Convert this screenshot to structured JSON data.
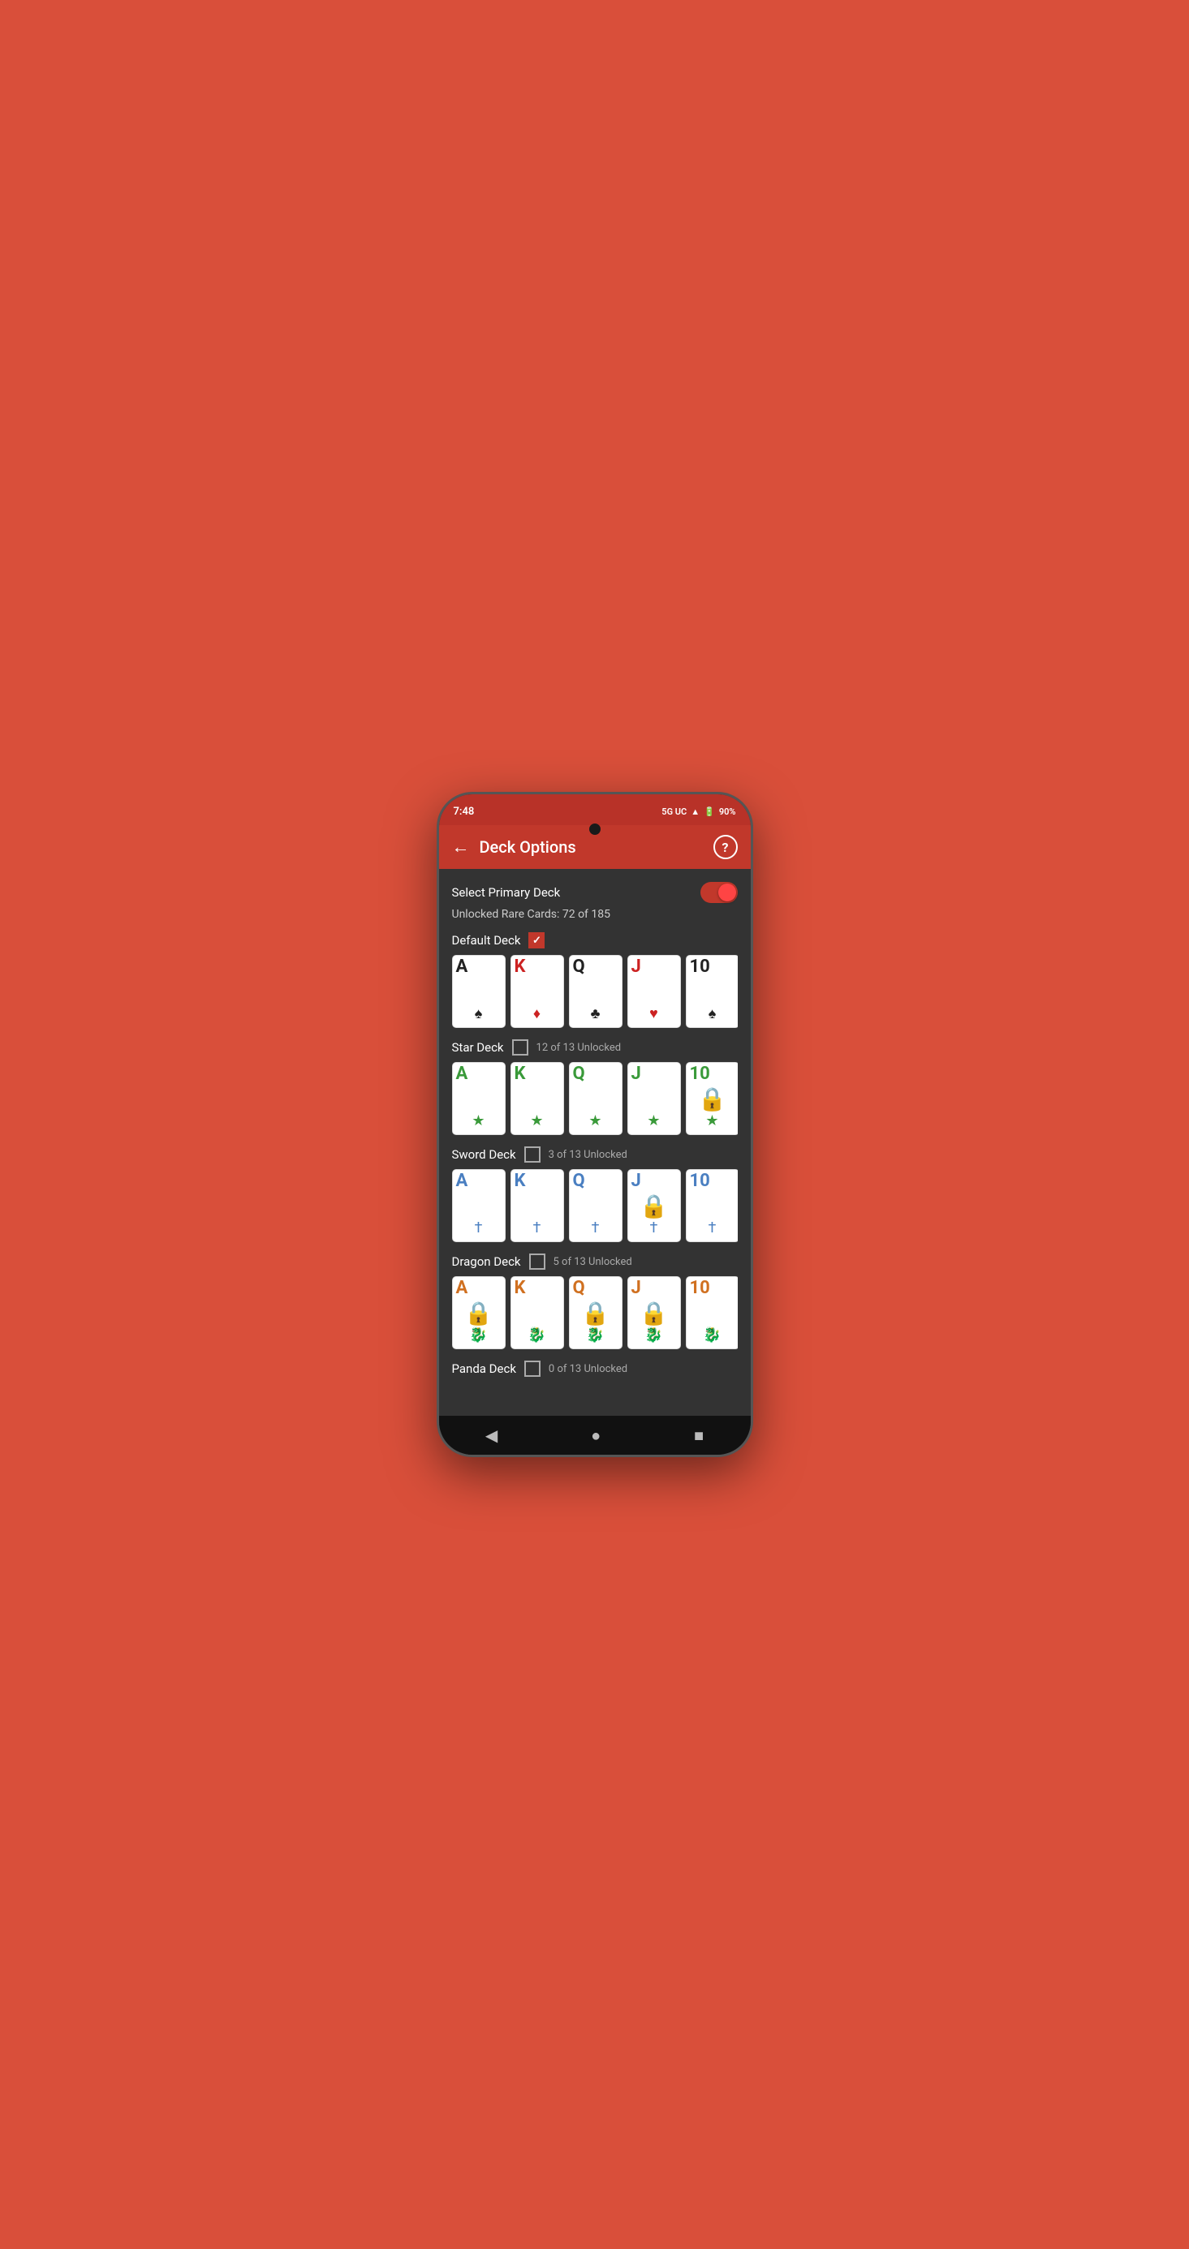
{
  "statusBar": {
    "time": "7:48",
    "network": "5G UC",
    "battery": "90%"
  },
  "topBar": {
    "title": "Deck Options",
    "backLabel": "←",
    "helpLabel": "?"
  },
  "selectPrimaryDeck": {
    "label": "Select Primary Deck",
    "toggleOn": true
  },
  "unlockedRare": {
    "text": "Unlocked Rare Cards: 72 of 185"
  },
  "decks": [
    {
      "name": "Default Deck",
      "checked": true,
      "unlockText": "",
      "cards": [
        {
          "value": "A",
          "suit": "♠",
          "suitColor": "black",
          "valueColor": "black",
          "locked": false,
          "symbol": "♠"
        },
        {
          "value": "K",
          "suit": "♦",
          "suitColor": "red",
          "valueColor": "red",
          "locked": false,
          "symbol": "♦"
        },
        {
          "value": "Q",
          "suit": "♣",
          "suitColor": "black",
          "valueColor": "black",
          "locked": false,
          "symbol": "♣"
        },
        {
          "value": "J",
          "suit": "♥",
          "suitColor": "red",
          "valueColor": "red",
          "locked": false,
          "symbol": "♥"
        },
        {
          "value": "10",
          "suit": "♠",
          "suitColor": "black",
          "valueColor": "black",
          "locked": false,
          "symbol": "♠"
        }
      ]
    },
    {
      "name": "Star Deck",
      "checked": false,
      "unlockText": "12 of 13 Unlocked",
      "cards": [
        {
          "value": "A",
          "suit": "★",
          "suitColor": "green",
          "valueColor": "green",
          "locked": false,
          "symbol": "★"
        },
        {
          "value": "K",
          "suit": "★",
          "suitColor": "green",
          "valueColor": "green",
          "locked": false,
          "symbol": "★"
        },
        {
          "value": "Q",
          "suit": "★",
          "suitColor": "green",
          "valueColor": "green",
          "locked": false,
          "symbol": "★"
        },
        {
          "value": "J",
          "suit": "★",
          "suitColor": "green",
          "valueColor": "green",
          "locked": false,
          "symbol": "★"
        },
        {
          "value": "10",
          "suit": "★",
          "suitColor": "green",
          "valueColor": "green",
          "locked": true,
          "symbol": "★"
        }
      ]
    },
    {
      "name": "Sword Deck",
      "checked": false,
      "unlockText": "3 of 13 Unlocked",
      "cards": [
        {
          "value": "A",
          "suit": "⚔",
          "suitColor": "blue",
          "valueColor": "blue",
          "locked": false,
          "symbol": "†"
        },
        {
          "value": "K",
          "suit": "⚔",
          "suitColor": "blue",
          "valueColor": "blue",
          "locked": false,
          "symbol": "†"
        },
        {
          "value": "Q",
          "suit": "⚔",
          "suitColor": "blue",
          "valueColor": "blue",
          "locked": false,
          "symbol": "†"
        },
        {
          "value": "J",
          "suit": "⚔",
          "suitColor": "blue",
          "valueColor": "blue",
          "locked": true,
          "symbol": "†"
        },
        {
          "value": "10",
          "suit": "⚔",
          "suitColor": "blue",
          "valueColor": "blue",
          "locked": false,
          "symbol": "†"
        }
      ]
    },
    {
      "name": "Dragon Deck",
      "checked": false,
      "unlockText": "5 of 13 Unlocked",
      "cards": [
        {
          "value": "A",
          "suit": "🐉",
          "suitColor": "orange",
          "valueColor": "orange",
          "locked": true,
          "symbol": "🐉"
        },
        {
          "value": "K",
          "suit": "🐉",
          "suitColor": "orange",
          "valueColor": "orange",
          "locked": false,
          "symbol": "🐉"
        },
        {
          "value": "Q",
          "suit": "🐉",
          "suitColor": "orange",
          "valueColor": "orange",
          "locked": true,
          "symbol": "🐉"
        },
        {
          "value": "J",
          "suit": "🐉",
          "suitColor": "orange",
          "valueColor": "orange",
          "locked": true,
          "symbol": "🐉"
        },
        {
          "value": "10",
          "suit": "🐉",
          "suitColor": "orange",
          "valueColor": "orange",
          "locked": false,
          "symbol": "🐉"
        }
      ]
    },
    {
      "name": "Panda Deck",
      "checked": false,
      "unlockText": "0 of 13 Unlocked",
      "cards": []
    }
  ],
  "bottomNav": {
    "back": "◀",
    "home": "●",
    "recent": "■"
  }
}
